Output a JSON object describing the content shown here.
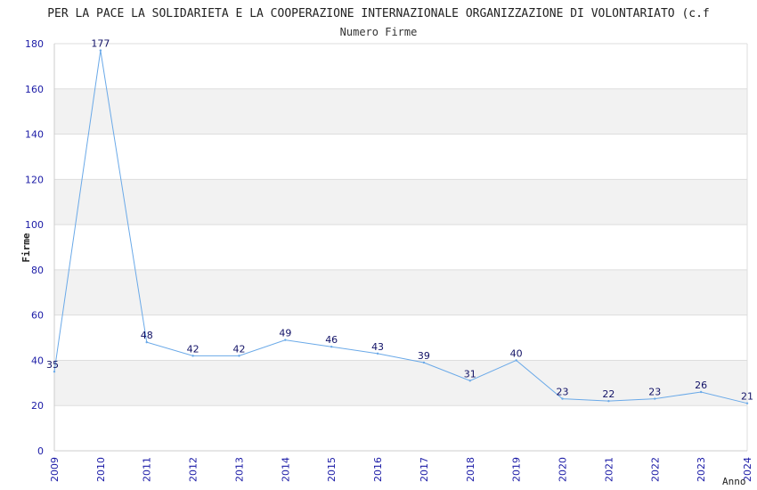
{
  "chart_data": {
    "type": "line",
    "title": "PER LA PACE LA SOLIDARIETA E LA COOPERAZIONE INTERNAZIONALE ORGANIZZAZIONE DI VOLONTARIATO (c.f",
    "subtitle": "Numero Firme",
    "xlabel": "Anno",
    "ylabel": "Firme",
    "x": [
      "2009",
      "2010",
      "2011",
      "2012",
      "2013",
      "2014",
      "2015",
      "2016",
      "2017",
      "2018",
      "2019",
      "2020",
      "2021",
      "2022",
      "2023",
      "2024"
    ],
    "series": [
      {
        "values": [
          35,
          177,
          48,
          42,
          42,
          49,
          46,
          43,
          39,
          31,
          40,
          23,
          22,
          23,
          26,
          21
        ]
      }
    ],
    "data_labels": [
      "35",
      "177",
      "48",
      "42",
      "42",
      "49",
      "46",
      "43",
      "39",
      "31",
      "40",
      "23",
      "22",
      "23",
      "26",
      "21"
    ],
    "ylim": [
      0,
      180
    ],
    "yticks": [
      0,
      20,
      40,
      60,
      80,
      100,
      120,
      140,
      160,
      180
    ],
    "grid": true,
    "line_color": "#6aa9e8",
    "tick_label_color": "#1a1aa6",
    "data_label_color": "#111166",
    "band_color": "#f2f2f2"
  }
}
